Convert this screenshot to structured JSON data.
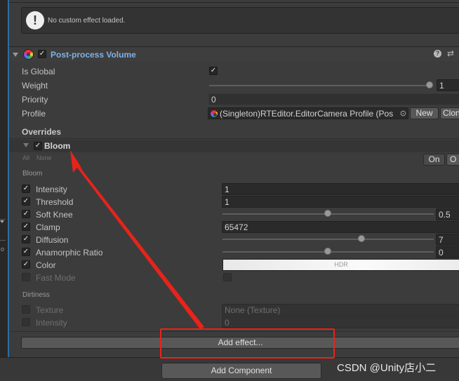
{
  "info": {
    "message": "No custom effect loaded."
  },
  "component": {
    "title": "Post-process Volume",
    "enabled": true,
    "fields": {
      "is_global_label": "Is Global",
      "is_global": true,
      "weight_label": "Weight",
      "weight_value": "1",
      "weight": 1.0,
      "priority_label": "Priority",
      "priority_value": "0",
      "profile_label": "Profile",
      "profile_value": "(Singleton)RTEditor.EditorCamera Profile (Pos",
      "new_button": "New",
      "clone_button": "Clon"
    },
    "overrides_label": "Overrides"
  },
  "bloom": {
    "title": "Bloom",
    "enabled": true,
    "all_label": "All",
    "none_label": "None",
    "on_label": "On",
    "off_label": "O",
    "section_bloom": "Bloom",
    "intensity_label": "Intensity",
    "intensity_value": "1",
    "threshold_label": "Threshold",
    "threshold_value": "1",
    "soft_knee_label": "Soft Knee",
    "soft_knee_value": "0.5",
    "soft_knee": 0.5,
    "clamp_label": "Clamp",
    "clamp_value": "65472",
    "diffusion_label": "Diffusion",
    "diffusion_value": "7",
    "diffusion": 0.667,
    "anamorphic_label": "Anamorphic Ratio",
    "anamorphic_value": "0",
    "anamorphic": 0.5,
    "color_label": "Color",
    "color_hdr": "HDR",
    "fast_mode_label": "Fast Mode",
    "section_dirtiness": "Dirtiness",
    "texture_label": "Texture",
    "texture_value": "None (Texture)",
    "dirt_intensity_label": "Intensity",
    "dirt_intensity_value": "0"
  },
  "buttons": {
    "add_effect": "Add effect...",
    "add_component": "Add Component"
  },
  "watermark": "CSDN @Unity店小二",
  "colors": {
    "accent": "#7fb2e6",
    "annotation": "#e8231a",
    "panel": "#3c3c3c"
  },
  "icons": [
    "info-icon",
    "post-process-icon",
    "help-icon",
    "settings-icon",
    "check-icon",
    "foldout-arrow-icon",
    "object-picker-icon"
  ]
}
